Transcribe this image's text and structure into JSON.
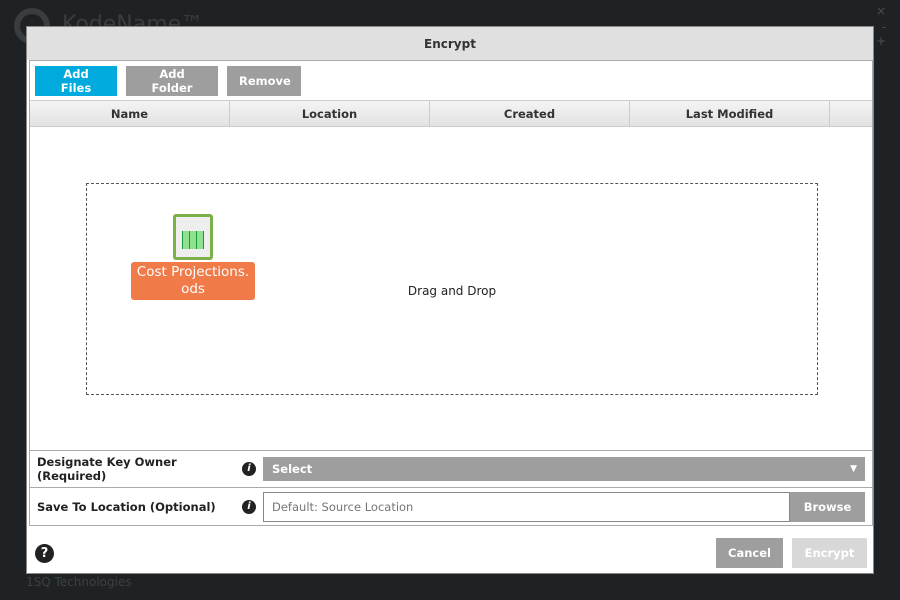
{
  "background": {
    "app_name": "KodeName™",
    "footer": "1SQ Technologies"
  },
  "dialog": {
    "title": "Encrypt",
    "toolbar": {
      "add_files": "Add Files",
      "add_folder": "Add Folder",
      "remove": "Remove"
    },
    "columns": [
      "Name",
      "Location",
      "Created",
      "Last Modified"
    ],
    "drop_zone": {
      "text": "Drag and Drop",
      "file": {
        "name": "Cost Projections.",
        "ext": "ods",
        "icon": "spreadsheet-file-icon"
      }
    },
    "key_owner": {
      "label": "Designate Key Owner (Required)",
      "value": "Select"
    },
    "save_location": {
      "label": "Save To Location (Optional)",
      "placeholder": "Default: Source Location",
      "browse": "Browse"
    },
    "footer": {
      "cancel": "Cancel",
      "encrypt": "Encrypt"
    }
  },
  "colors": {
    "accent": "#00aadd",
    "file_highlight": "#f07a48",
    "button_gray": "#9e9e9e"
  }
}
